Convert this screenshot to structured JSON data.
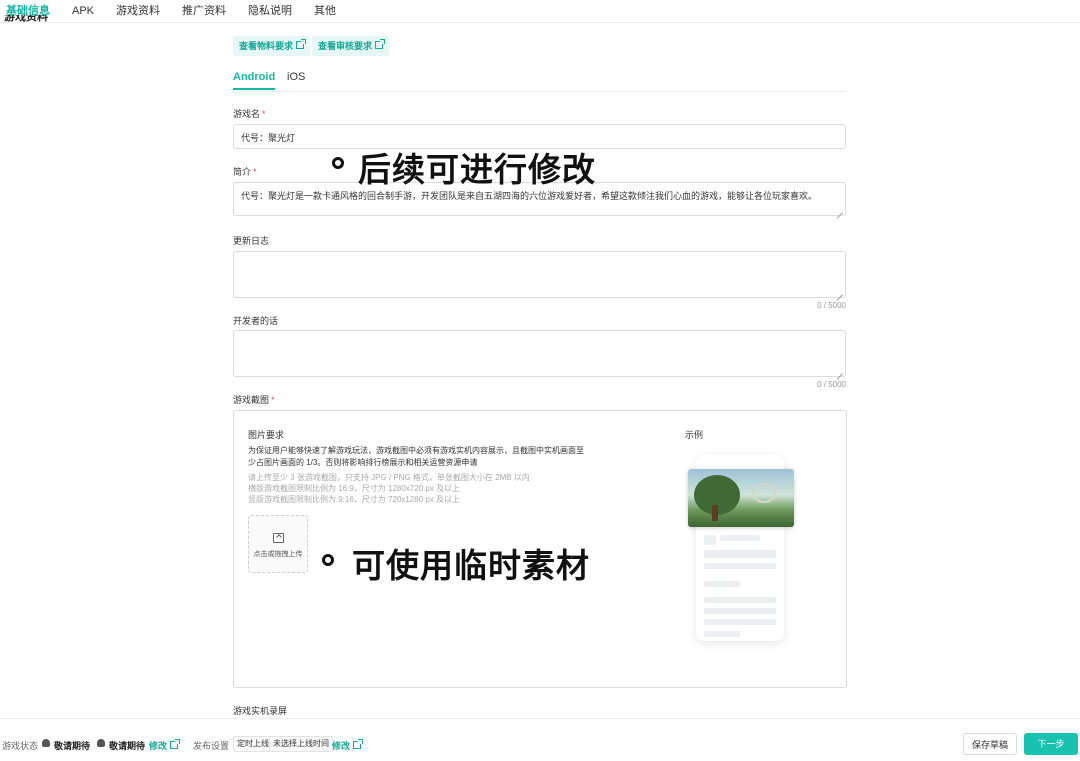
{
  "nav": {
    "tabs": [
      {
        "label": "基础信息",
        "active": true
      },
      {
        "label": "APK"
      },
      {
        "label": "游戏资料"
      },
      {
        "label": "推广资料"
      },
      {
        "label": "隐私说明"
      },
      {
        "label": "其他"
      }
    ],
    "cut_heading": "游戏资料"
  },
  "links": {
    "material": "查看物料要求",
    "review": "查看审核要求"
  },
  "platform_tabs": [
    {
      "label": "Android",
      "active": true
    },
    {
      "label": "iOS"
    }
  ],
  "form": {
    "game_name_label": "游戏名",
    "game_name_value": "代号：聚光灯",
    "intro_label": "简介",
    "intro_value": "代号：聚光灯是一款卡通风格的回合制手游，开发团队是来自五湖四海的六位游戏爱好者，希望这款倾注我们心血的游戏，能够让各位玩家喜欢。",
    "changelog_label": "更新日志",
    "changelog_counter": "0 / 5000",
    "dev_words_label": "开发者的话",
    "dev_words_counter": "0 / 5000",
    "screenshots_label": "游戏截图",
    "video_label": "游戏实机录屏"
  },
  "screenshots": {
    "req_title": "图片要求",
    "req_desc": "为保证用户能够快速了解游戏玩法，游戏截图中必须有游戏实机内容展示，且截图中实机画面至少占图片画面的 1/3。否则将影响排行榜展示和相关运营资源申请",
    "note1": "请上传至少 3 张游戏截图，只支持 JPG / PNG 格式，单张截图大小在 2MB 以内",
    "note2": "横版游戏截图限制比例为 16:9，尺寸为 1280x720 px 及以上",
    "note3": "竖版游戏截图限制比例为 9:16，尺寸为 720x1280 px 及以上",
    "upload_label": "点击或拖拽上传",
    "example_label": "示例"
  },
  "annotations": {
    "a1": "后续可进行修改",
    "a2": "可使用临时素材"
  },
  "bottom": {
    "status_label": "游戏状态",
    "android_status": "敬请期待",
    "ios_status": "敬请期待",
    "edit1": "修改",
    "publish_label": "发布设置",
    "tag1": "定时上线",
    "tag2": "未选择上线时间",
    "edit2": "修改",
    "save_draft": "保存草稿",
    "next": "下一步"
  },
  "colors": {
    "accent": "#15b8a6",
    "required": "#e5484d"
  }
}
